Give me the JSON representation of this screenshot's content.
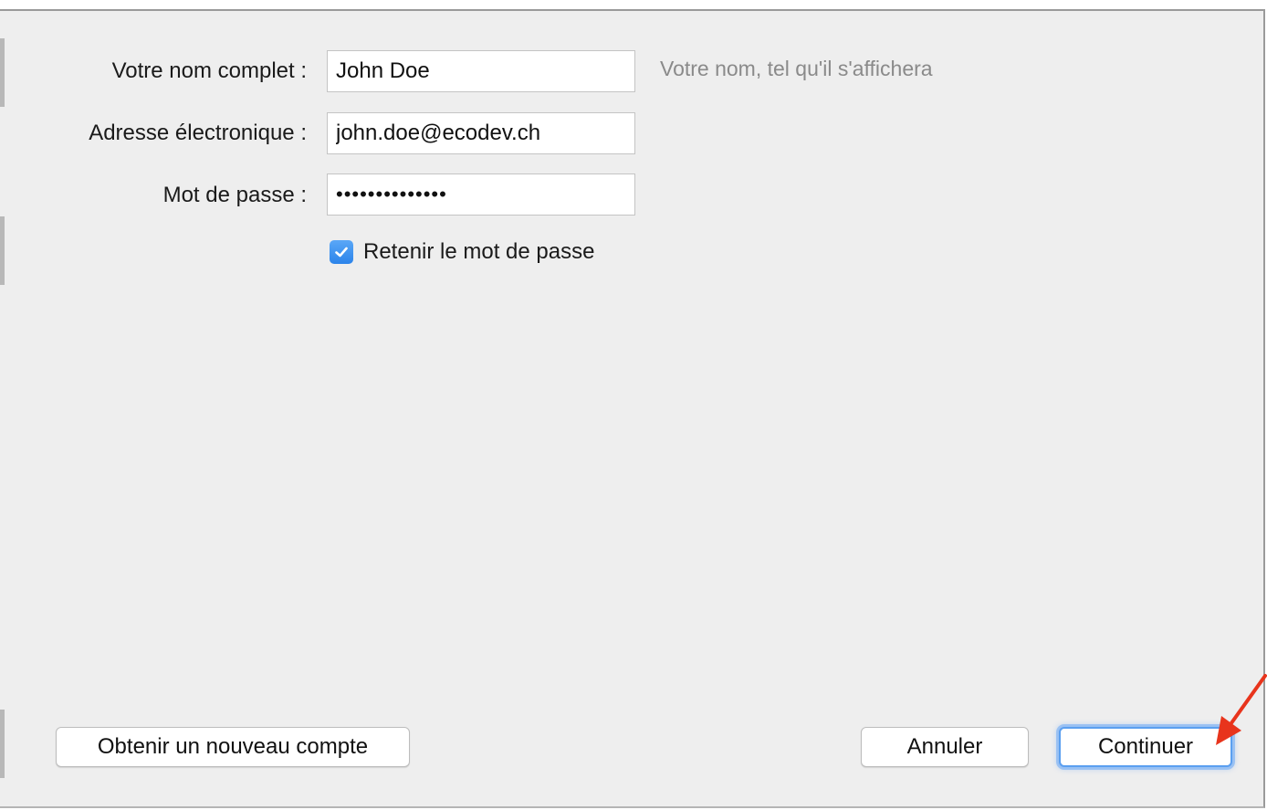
{
  "form": {
    "full_name": {
      "label": "Votre nom complet :",
      "value": "John Doe",
      "hint": "Votre nom, tel qu'il s'affichera"
    },
    "email": {
      "label": "Adresse électronique :",
      "value": "john.doe@ecodev.ch"
    },
    "password": {
      "label": "Mot de passe :",
      "value": "••••••••••••••"
    },
    "remember_password": {
      "label": "Retenir le mot de passe",
      "checked": true
    }
  },
  "buttons": {
    "new_account": "Obtenir un nouveau compte",
    "cancel": "Annuler",
    "continue": "Continuer"
  },
  "colors": {
    "accent": "#2c84ea",
    "annotation_arrow": "#e8341c",
    "dialog_background": "#eeeeee"
  },
  "icons": {
    "checkbox": "checkmark-icon",
    "annotation": "red-arrow-icon"
  }
}
